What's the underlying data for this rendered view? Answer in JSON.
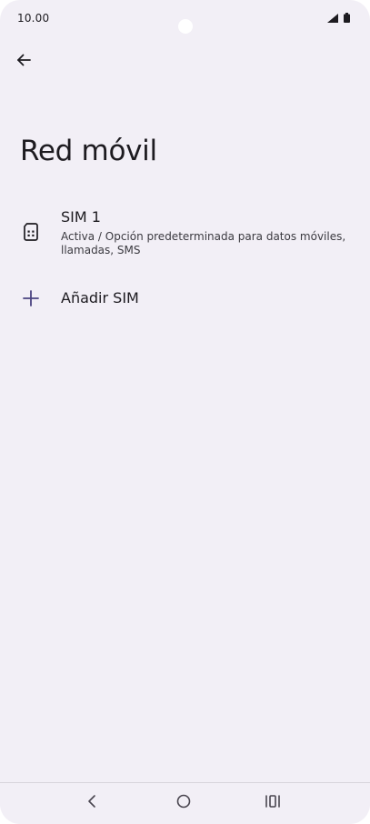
{
  "status_bar": {
    "time": "10.00",
    "icons": [
      "signal-icon",
      "battery-icon"
    ]
  },
  "app_bar": {
    "back_icon": "arrow-back-icon"
  },
  "page": {
    "title": "Red móvil"
  },
  "sim_list": {
    "sim1": {
      "title": "SIM 1",
      "summary": "Activa / Opción predeterminada para datos móviles, llamadas, SMS",
      "icon": "sim-card-icon"
    },
    "add_sim": {
      "label": "Añadir SIM",
      "icon": "plus-icon"
    }
  },
  "nav_bar": {
    "icons": [
      "nav-back-icon",
      "nav-home-icon",
      "nav-recents-icon"
    ]
  },
  "colors": {
    "background": "#f2eff6",
    "text": "#1d1b20",
    "accent": "#4a4380"
  }
}
